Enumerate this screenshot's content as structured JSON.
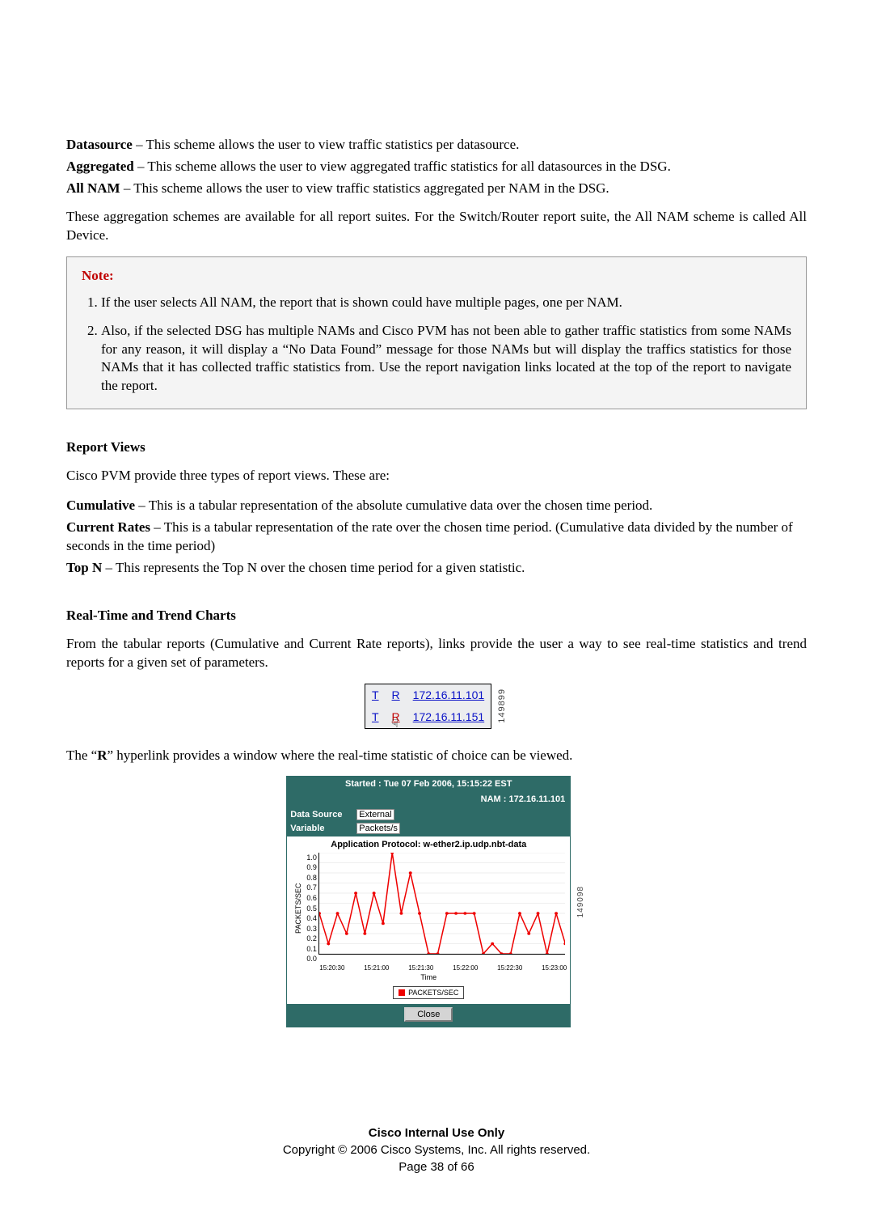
{
  "defs": [
    {
      "term": "Datasource",
      "text": " – This scheme allows the user to view traffic statistics per datasource."
    },
    {
      "term": "Aggregated",
      "text": " – This scheme allows the user to view aggregated traffic statistics for all datasources in the DSG."
    },
    {
      "term": "All NAM",
      "text": " – This scheme allows the user to view traffic statistics aggregated per NAM in the DSG."
    }
  ],
  "para_after_defs": "These aggregation schemes are available for all report suites. For the Switch/Router report suite, the All NAM scheme is called All Device.",
  "note": {
    "title": "Note:",
    "items": [
      "If the user selects All NAM, the report that is shown could have multiple pages, one per NAM.",
      "Also, if the selected DSG has multiple NAMs and Cisco PVM has not been able to gather traffic statistics from some NAMs for any reason, it will display a “No Data Found” message for those NAMs but will display the traffics statistics for those NAMs that it has collected traffic statistics from. Use the report navigation links located at the top of the report to navigate the report."
    ]
  },
  "report_views": {
    "heading": "Report Views",
    "intro": "Cisco PVM provide three types of report views. These are:",
    "items": [
      {
        "term": "Cumulative",
        "text": " – This is a tabular representation of the absolute cumulative data over the chosen time period."
      },
      {
        "term": "Current Rates",
        "text": " – This is a tabular representation of the rate over the chosen time period. (Cumulative data divided by the number of seconds in the time period)"
      },
      {
        "term": "Top N",
        "text": " – This represents the Top N over the chosen time period for a given statistic."
      }
    ]
  },
  "rt_section": {
    "heading": "Real-Time and Trend Charts",
    "intro": "From the tabular reports (Cumulative and Current Rate reports), links provide the user a way to see real-time statistics and trend reports for a given set of parameters.",
    "after_table_pre": "The “",
    "after_table_bold": "R",
    "after_table_post": "” hyperlink provides a window where the real-time statistic of choice can be viewed."
  },
  "links_table": {
    "rows": [
      {
        "t": "T",
        "r": "R",
        "r_hover": false,
        "ip": "172.16.11.101"
      },
      {
        "t": "T",
        "r": "R",
        "r_hover": true,
        "ip": "172.16.11.151"
      }
    ],
    "fig_id": "149899"
  },
  "rt_panel": {
    "started": "Started : Tue 07 Feb 2006, 15:15:22 EST",
    "nam": "NAM : 172.16.11.101",
    "labels": {
      "datasource": "Data Source",
      "variable": "Variable"
    },
    "datasource": "External",
    "variable": "Packets/s",
    "chart_title": "Application Protocol: w-ether2.ip.udp.nbt-data",
    "ylabel": "PACKETS/SEC",
    "xlabel": "Time",
    "legend": "PACKETS/SEC",
    "close": "Close",
    "fig_id": "149098"
  },
  "chart_data": {
    "type": "line",
    "title": "Application Protocol: w-ether2.ip.udp.nbt-data",
    "xlabel": "Time",
    "ylabel": "PACKETS/SEC",
    "ylim": [
      0.0,
      1.0
    ],
    "y_ticks": [
      "1.0",
      "0.9",
      "0.8",
      "0.7",
      "0.6",
      "0.5",
      "0.4",
      "0.3",
      "0.2",
      "0.1",
      "0.0"
    ],
    "x_ticks": [
      "15:20:30",
      "15:21:00",
      "15:21:30",
      "15:22:00",
      "15:22:30",
      "15:23:00"
    ],
    "series": [
      {
        "name": "PACKETS/SEC",
        "color": "#e00000",
        "values": [
          0.4,
          0.1,
          0.4,
          0.2,
          0.6,
          0.2,
          0.6,
          0.3,
          1.0,
          0.4,
          0.8,
          0.4,
          0.0,
          0.0,
          0.4,
          0.4,
          0.4,
          0.4,
          0.0,
          0.1,
          0.0,
          0.0,
          0.4,
          0.2,
          0.4,
          0.0,
          0.4,
          0.1
        ]
      }
    ]
  },
  "footer": {
    "line1": "Cisco Internal Use Only",
    "line2": "Copyright © 2006 Cisco Systems, Inc. All rights reserved.",
    "line3": "Page 38 of 66"
  }
}
